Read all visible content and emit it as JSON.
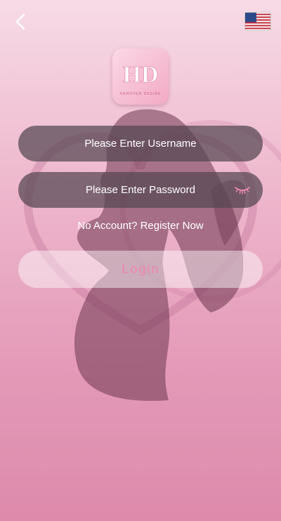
{
  "header": {
    "back_icon": "chevron-left-icon",
    "language_icon": "us-flag-icon"
  },
  "logo": {
    "letters": "HD",
    "tagline": "HANOVER DESIRE"
  },
  "form": {
    "username_placeholder": "Please Enter Username",
    "password_placeholder": "Please Enter Password",
    "password_toggle_icon": "eye-closed-icon",
    "register_link": "No Account? Register Now",
    "login_label": "Login"
  },
  "colors": {
    "accent": "#e38fb2",
    "field_bg": "#554652"
  }
}
